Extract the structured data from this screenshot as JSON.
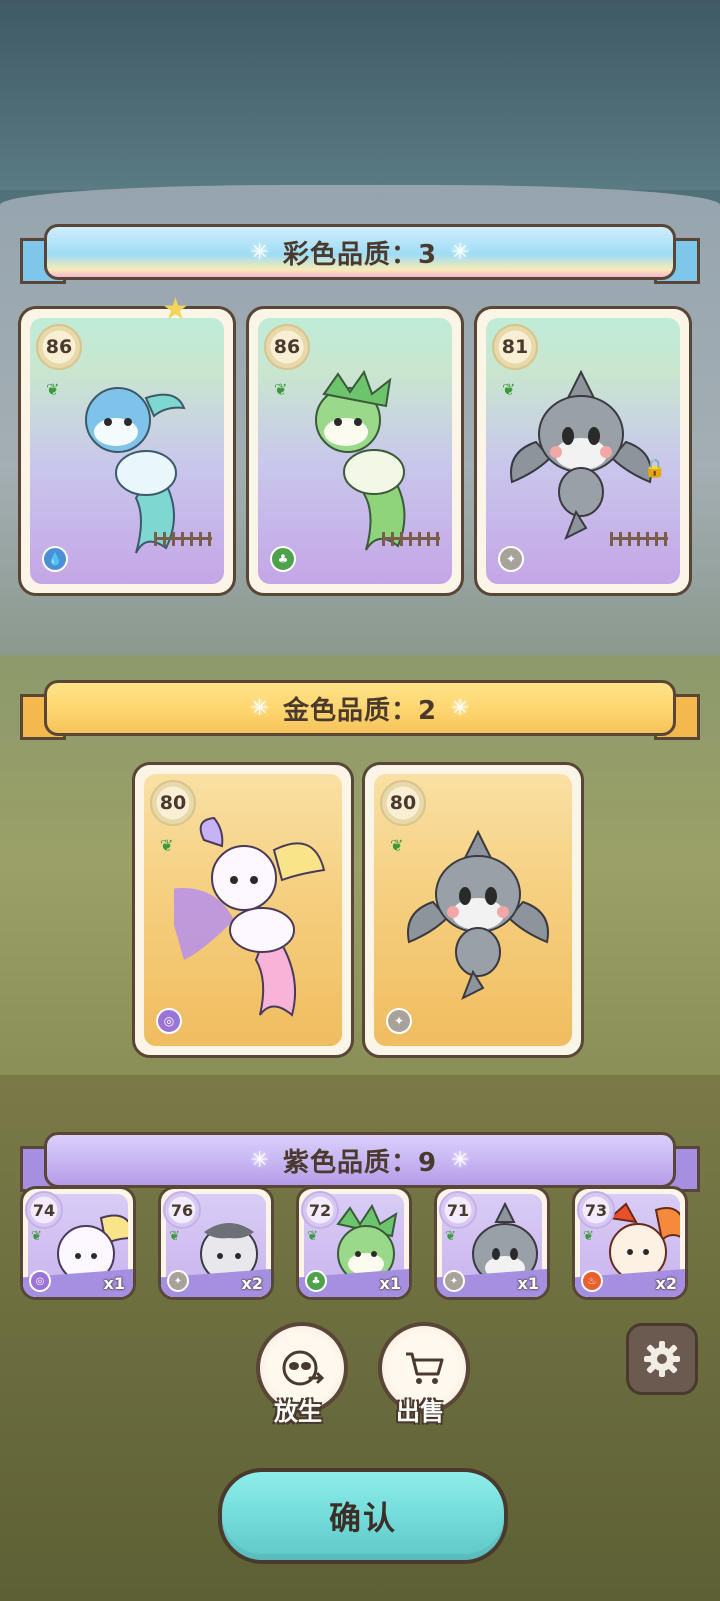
{
  "sections": {
    "rainbow": {
      "title": "彩色品质：3"
    },
    "gold": {
      "title": "金色品质：2"
    },
    "purple": {
      "title": "紫色品质：9"
    }
  },
  "rainbow_cards": [
    {
      "level": "86",
      "element": "water-icon",
      "locked": false
    },
    {
      "level": "86",
      "element": "grass-icon",
      "locked": false
    },
    {
      "level": "81",
      "element": "normal-icon",
      "locked": true
    }
  ],
  "gold_cards": [
    {
      "level": "80",
      "element": "psychic-icon"
    },
    {
      "level": "80",
      "element": "normal-icon"
    }
  ],
  "purple_cards": [
    {
      "level": "74",
      "count": "x1",
      "element": "psychic-icon"
    },
    {
      "level": "76",
      "count": "x2",
      "element": "normal-icon"
    },
    {
      "level": "72",
      "count": "x1",
      "element": "grass-icon"
    },
    {
      "level": "71",
      "count": "x1",
      "element": "normal-icon"
    },
    {
      "level": "73",
      "count": "x2",
      "element": "fire-icon"
    }
  ],
  "actions": {
    "release": "放生",
    "sell": "出售"
  },
  "confirm": "确认",
  "colors": {
    "rainbow": "#9fdcf6",
    "gold": "#fdd36c",
    "purple": "#c4b2f2",
    "confirm": "#6fd8d6",
    "outline": "#5a4636"
  }
}
